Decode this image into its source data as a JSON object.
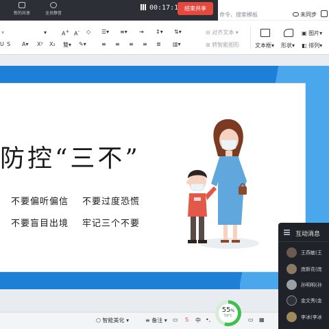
{
  "share_bar": {
    "tool1": "新的共享",
    "tool2": "全员静音",
    "timer": "00:17:10",
    "end_button": "结束共享"
  },
  "ribbon": {
    "search_hint": "命令、搜索模板",
    "unsync": "未同步",
    "align_text": "对齐文本",
    "smartart": "转智能图形",
    "textbox": "文本框",
    "shape": "形状",
    "picture": "图片",
    "arrange": "排列"
  },
  "slide": {
    "title": "防控“三不”",
    "bullets": [
      "不要偏听偏信",
      "不要过度恐慌",
      "不要盲目出境",
      "牢记三个不要"
    ]
  },
  "status": {
    "smart_beautify": "智能美化",
    "notes": "备注",
    "cpu_percent": "55",
    "cpu_unit": "%",
    "temperature": "59°C"
  },
  "chat": {
    "title": "互动消息",
    "users": [
      "王燕敏(王",
      "庞新花(庞",
      "孙明明(孙",
      "金文秀(金",
      "李冰(李冰"
    ]
  },
  "colors": {
    "end_button": "#e5483d",
    "slide_frame": "#1e7fd6",
    "gauge": "#3fbf4f"
  }
}
